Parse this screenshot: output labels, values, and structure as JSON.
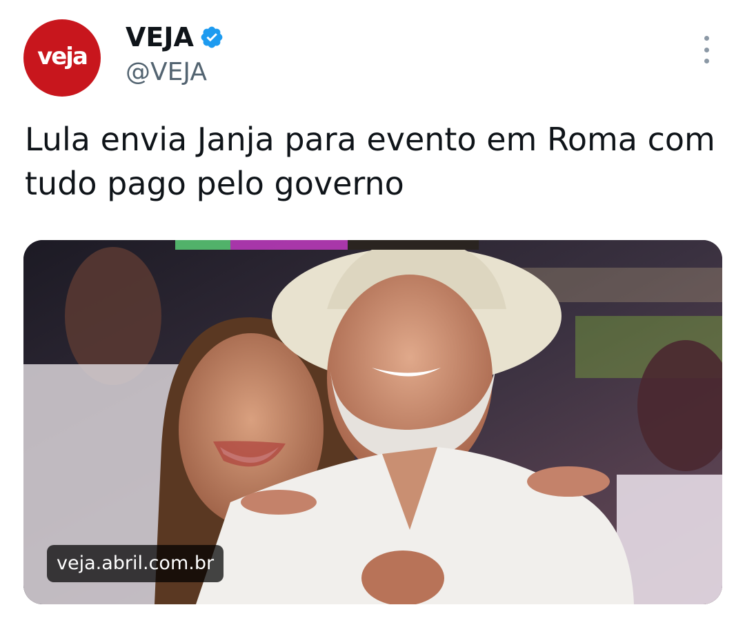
{
  "tweet": {
    "author": {
      "name": "VEJA",
      "handle": "@VEJA",
      "avatar_text": "veja",
      "verified": true,
      "avatar_color": "#c8161d"
    },
    "text": "Lula envia Janja para evento em Roma com tudo pago pelo governo",
    "media": {
      "domain": "veja.abril.com.br"
    },
    "more_icon": "more-vertical-icon",
    "verified_icon": "verified-badge-icon",
    "accent_color": "#1d9bf0"
  }
}
